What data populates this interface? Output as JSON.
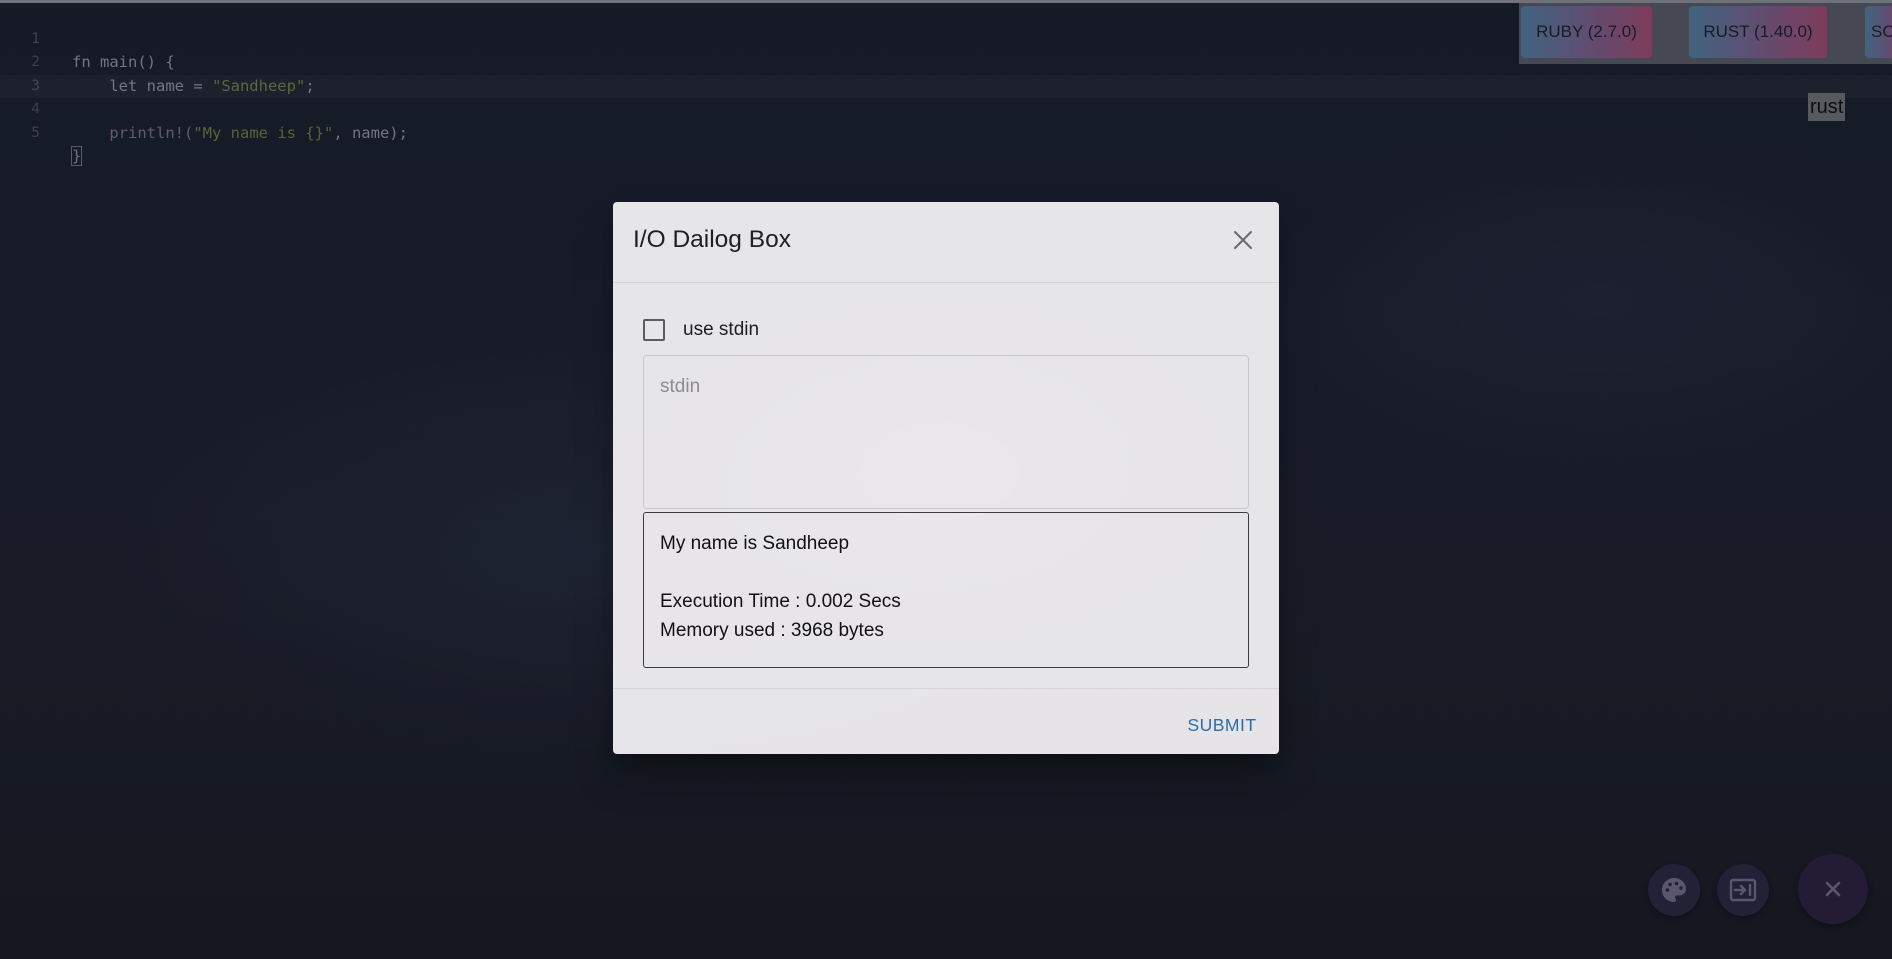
{
  "editor": {
    "line_numbers": [
      "1",
      "2",
      "3",
      "4",
      "5"
    ],
    "lines": {
      "l1": "fn main() {",
      "l2_pre": "    let name = ",
      "l2_str": "\"Sandheep\"",
      "l2_post": ";",
      "l4_pre": "    ",
      "l4_mac": "println!(",
      "l4_str": "\"My name is {}\"",
      "l4_post": ", name);",
      "l5": "}"
    },
    "language_indicator": "rust"
  },
  "languages": {
    "buttons": [
      "RUBY (2.7.0)",
      "RUST (1.40.0)",
      "SC"
    ]
  },
  "dialog": {
    "title": "I/O Dailog Box",
    "use_stdin_label": "use stdin",
    "stdin_placeholder": "stdin",
    "output": {
      "line1": "My name is Sandheep",
      "line2": "Execution Time : 0.002 Secs",
      "line3": "Memory used : 3968 bytes"
    },
    "submit_label": "SUBMIT"
  },
  "colors": {
    "accent": "#2a6eb0",
    "fab_background": "#2b2340"
  },
  "icons": {
    "close": "close-icon",
    "palette": "palette-icon",
    "io": "input-output-icon",
    "fab_close": "close-icon"
  }
}
